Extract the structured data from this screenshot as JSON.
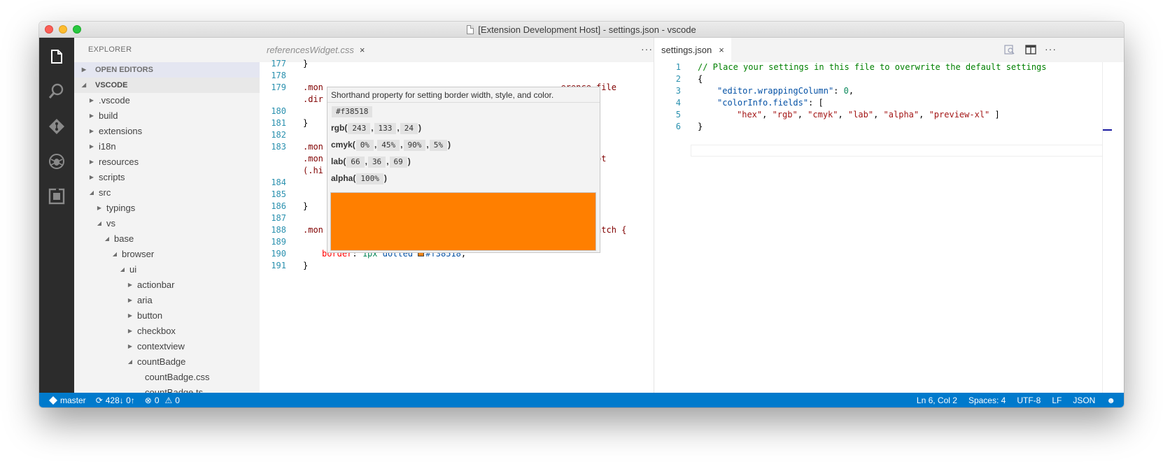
{
  "window": {
    "title": "[Extension Development Host] - settings.json - vscode"
  },
  "activity_bar": {
    "icons": [
      "files-icon",
      "search-icon",
      "git-icon",
      "debug-icon",
      "extensions-icon"
    ]
  },
  "sidebar": {
    "title": "EXPLORER",
    "open_editors": "OPEN EDITORS",
    "project": "VSCODE",
    "tree": [
      {
        "label": ".vscode",
        "depth": 1,
        "expanded": false
      },
      {
        "label": "build",
        "depth": 1,
        "expanded": false
      },
      {
        "label": "extensions",
        "depth": 1,
        "expanded": false
      },
      {
        "label": "i18n",
        "depth": 1,
        "expanded": false
      },
      {
        "label": "resources",
        "depth": 1,
        "expanded": false
      },
      {
        "label": "scripts",
        "depth": 1,
        "expanded": false
      },
      {
        "label": "src",
        "depth": 1,
        "expanded": true
      },
      {
        "label": "typings",
        "depth": 2,
        "expanded": false
      },
      {
        "label": "vs",
        "depth": 2,
        "expanded": true
      },
      {
        "label": "base",
        "depth": 3,
        "expanded": true
      },
      {
        "label": "browser",
        "depth": 4,
        "expanded": true
      },
      {
        "label": "ui",
        "depth": 5,
        "expanded": true
      },
      {
        "label": "actionbar",
        "depth": 6,
        "expanded": false
      },
      {
        "label": "aria",
        "depth": 6,
        "expanded": false
      },
      {
        "label": "button",
        "depth": 6,
        "expanded": false
      },
      {
        "label": "checkbox",
        "depth": 6,
        "expanded": false
      },
      {
        "label": "contextview",
        "depth": 6,
        "expanded": false
      },
      {
        "label": "countBadge",
        "depth": 6,
        "expanded": true
      },
      {
        "label": "countBadge.css",
        "depth": 7,
        "file": true
      },
      {
        "label": "countBadge.ts",
        "depth": 7,
        "file": true
      }
    ]
  },
  "editor_left": {
    "tab": {
      "label": "referencesWidget.css",
      "close": "×"
    },
    "more": "···",
    "lines": [
      {
        "n": "177",
        "text": "}",
        "cls": ""
      },
      {
        "n": "178",
        "text": "",
        "cls": ""
      },
      {
        "n": "179",
        "text": ".mon                                               erence-file",
        "cls": "sel"
      },
      {
        "n": "",
        "text": ".dir",
        "cls": "sel"
      },
      {
        "n": "180",
        "text": "",
        "cls": ""
      },
      {
        "n": "181",
        "text": "}",
        "cls": ""
      },
      {
        "n": "182",
        "text": "",
        "cls": ""
      },
      {
        "n": "183",
        "text": ".mon",
        "cls": "sel"
      },
      {
        "n": "",
        "text": ".mon                                               ected:not",
        "cls": "sel"
      },
      {
        "n": "",
        "text": "(.hi",
        "cls": "sel"
      },
      {
        "n": "184",
        "text": "",
        "cls": ""
      },
      {
        "n": "185",
        "text": "",
        "cls": ""
      },
      {
        "n": "186",
        "text": "}",
        "cls": ""
      },
      {
        "n": "187",
        "text": "",
        "cls": ""
      },
      {
        "n": "188",
        "text": ".mon                                               erenceMatch {",
        "cls": "sel"
      },
      {
        "n": "189",
        "text": "",
        "cls": ""
      }
    ],
    "line190": {
      "n": "190",
      "prop": "border",
      "colon": ": ",
      "num": "1px",
      "rest": " dotted ",
      "color": "#f38518",
      "end": ";"
    },
    "line191": {
      "n": "191",
      "text": "}"
    }
  },
  "hover": {
    "description": "Shorthand property for setting border width, style, and color.",
    "hex": "#f38518",
    "rgb": {
      "label": "rgb(",
      "values": [
        "243",
        "133",
        "24"
      ]
    },
    "cmyk": {
      "label": "cmyk(",
      "values": [
        "0%",
        "45%",
        "90%",
        "5%"
      ]
    },
    "lab": {
      "label": "lab(",
      "values": [
        "66",
        "36",
        "69"
      ]
    },
    "alpha": {
      "label": "alpha(",
      "values": [
        "100%"
      ]
    },
    "close_paren": ")",
    "swatch_color": "#ff7f00"
  },
  "editor_right": {
    "tab": {
      "label": "settings.json",
      "close": "×"
    },
    "more": "···",
    "lines": [
      {
        "n": "1"
      },
      {
        "n": "2"
      },
      {
        "n": "3"
      },
      {
        "n": "4"
      },
      {
        "n": "5"
      },
      {
        "n": "6"
      }
    ],
    "code": {
      "l1": "// Place your settings in this file to overwrite the default settings",
      "l2": "{",
      "l3_key": "\"editor.wrappingColumn\"",
      "l3_num": "0",
      "l4_key": "\"colorInfo.fields\"",
      "l4_rest": ": [",
      "l5_items": [
        "\"hex\"",
        "\"rgb\"",
        "\"cmyk\"",
        "\"lab\"",
        "\"alpha\"",
        "\"preview-xl\""
      ],
      "l5_end": " ]",
      "l6": "}"
    }
  },
  "statusbar": {
    "branch": "master",
    "sync": "428↓ 0↑",
    "errors": "0",
    "warnings": "0",
    "position": "Ln 6, Col 2",
    "spaces": "Spaces: 4",
    "encoding": "UTF-8",
    "eol": "LF",
    "language": "JSON"
  },
  "colors": {
    "accent": "#007acc",
    "activity": "#2c2c2c",
    "sidebar": "#f3f3f3"
  }
}
